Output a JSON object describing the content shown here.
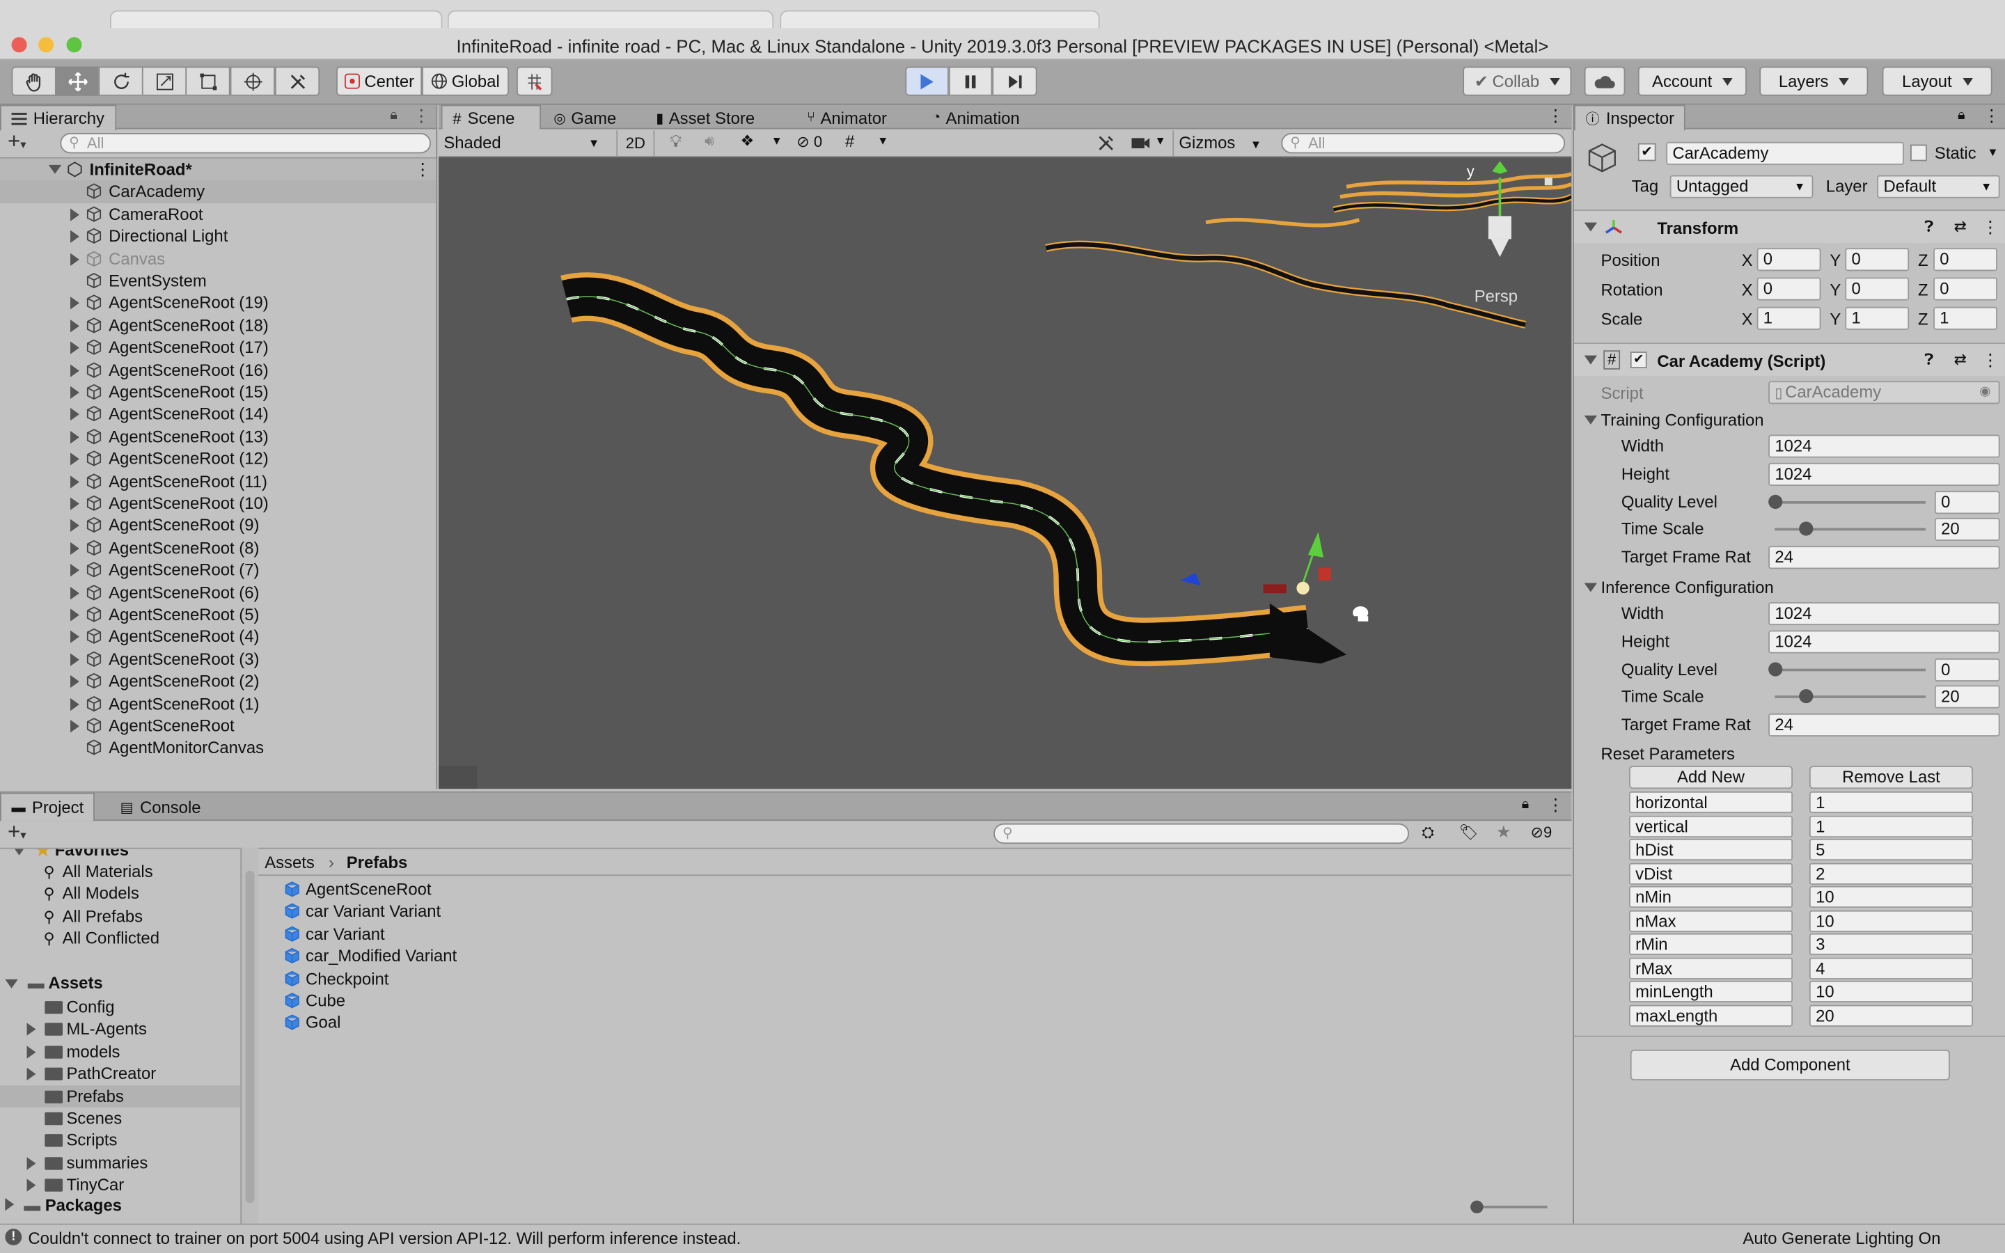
{
  "window": {
    "title": "InfiniteRoad - infinite road - PC, Mac & Linux Standalone - Unity 2019.3.0f3 Personal [PREVIEW PACKAGES IN USE] (Personal) <Metal>"
  },
  "toolbar": {
    "center_label": "Center",
    "global_label": "Global",
    "collab_label": "Collab",
    "account_label": "Account",
    "layers_label": "Layers",
    "layout_label": "Layout"
  },
  "hierarchy": {
    "tab_label": "Hierarchy",
    "search_placeholder": "All",
    "scene_name": "InfiniteRoad*",
    "items": [
      "CarAcademy",
      "CameraRoot",
      "Directional Light",
      "Canvas",
      "EventSystem",
      "AgentSceneRoot (19)",
      "AgentSceneRoot (18)",
      "AgentSceneRoot (17)",
      "AgentSceneRoot (16)",
      "AgentSceneRoot (15)",
      "AgentSceneRoot (14)",
      "AgentSceneRoot (13)",
      "AgentSceneRoot (12)",
      "AgentSceneRoot (11)",
      "AgentSceneRoot (10)",
      "AgentSceneRoot (9)",
      "AgentSceneRoot (8)",
      "AgentSceneRoot (7)",
      "AgentSceneRoot (6)",
      "AgentSceneRoot (5)",
      "AgentSceneRoot (4)",
      "AgentSceneRoot (3)",
      "AgentSceneRoot (2)",
      "AgentSceneRoot (1)",
      "AgentSceneRoot",
      "AgentMonitorCanvas"
    ]
  },
  "scene": {
    "tabs": [
      "Scene",
      "Game",
      "Asset Store",
      "Animator",
      "Animation"
    ],
    "shading_mode": "Shaded",
    "mode_2d": "2D",
    "hidden_count": "0",
    "gizmos_label": "Gizmos",
    "search_placeholder": "All",
    "persp_label": "Persp",
    "axis_y_label": "y"
  },
  "project": {
    "tabs": [
      "Project",
      "Console"
    ],
    "hidden_count": "9",
    "favorites_label": "Favorites",
    "favorites": [
      "All Materials",
      "All Models",
      "All Prefabs",
      "All Conflicted"
    ],
    "assets_label": "Assets",
    "asset_folders": [
      "Config",
      "ML-Agents",
      "models",
      "PathCreator",
      "Prefabs",
      "Scenes",
      "Scripts",
      "summaries",
      "TinyCar"
    ],
    "packages_label": "Packages",
    "breadcrumb_root": "Assets",
    "breadcrumb_current": "Prefabs",
    "prefabs": [
      "AgentSceneRoot",
      "car Variant Variant",
      "car Variant",
      "car_Modified Variant",
      "Checkpoint",
      "Cube",
      "Goal"
    ]
  },
  "inspector": {
    "tab_label": "Inspector",
    "object_name": "CarAcademy",
    "static_label": "Static",
    "tag_label": "Tag",
    "tag_value": "Untagged",
    "layer_label": "Layer",
    "layer_value": "Default",
    "transform": {
      "title": "Transform",
      "position_label": "Position",
      "rotation_label": "Rotation",
      "scale_label": "Scale",
      "position": [
        "0",
        "0",
        "0"
      ],
      "rotation": [
        "0",
        "0",
        "0"
      ],
      "scale": [
        "1",
        "1",
        "1"
      ]
    },
    "script_component": {
      "title": "Car Academy (Script)",
      "script_label": "Script",
      "script_value": "CarAcademy"
    },
    "training": {
      "title": "Training Configuration",
      "width_label": "Width",
      "width": "1024",
      "height_label": "Height",
      "height": "1024",
      "quality_label": "Quality Level",
      "quality": "0",
      "timescale_label": "Time Scale",
      "timescale": "20",
      "framerate_label": "Target Frame Rat",
      "framerate": "24"
    },
    "inference": {
      "title": "Inference Configuration",
      "width_label": "Width",
      "width": "1024",
      "height_label": "Height",
      "height": "1024",
      "quality_label": "Quality Level",
      "quality": "0",
      "timescale_label": "Time Scale",
      "timescale": "20",
      "framerate_label": "Target Frame Rat",
      "framerate": "24"
    },
    "reset": {
      "title": "Reset Parameters",
      "add_label": "Add New",
      "remove_label": "Remove Last",
      "params": [
        {
          "key": "horizontal",
          "value": "1"
        },
        {
          "key": "vertical",
          "value": "1"
        },
        {
          "key": "hDist",
          "value": "5"
        },
        {
          "key": "vDist",
          "value": "2"
        },
        {
          "key": "nMin",
          "value": "10"
        },
        {
          "key": "nMax",
          "value": "10"
        },
        {
          "key": "rMin",
          "value": "3"
        },
        {
          "key": "rMax",
          "value": "4"
        },
        {
          "key": "minLength",
          "value": "10"
        },
        {
          "key": "maxLength",
          "value": "20"
        }
      ]
    },
    "add_component_label": "Add Component"
  },
  "status": {
    "message": "Couldn't connect to trainer on port 5004 using API version API-12. Will perform inference instead.",
    "right_text": "Auto Generate Lighting On"
  },
  "colors": {
    "road": "#0d0d0d",
    "road_border": "#e7a33e",
    "scene_bg": "#575757",
    "play_active": "#3f76d6"
  }
}
